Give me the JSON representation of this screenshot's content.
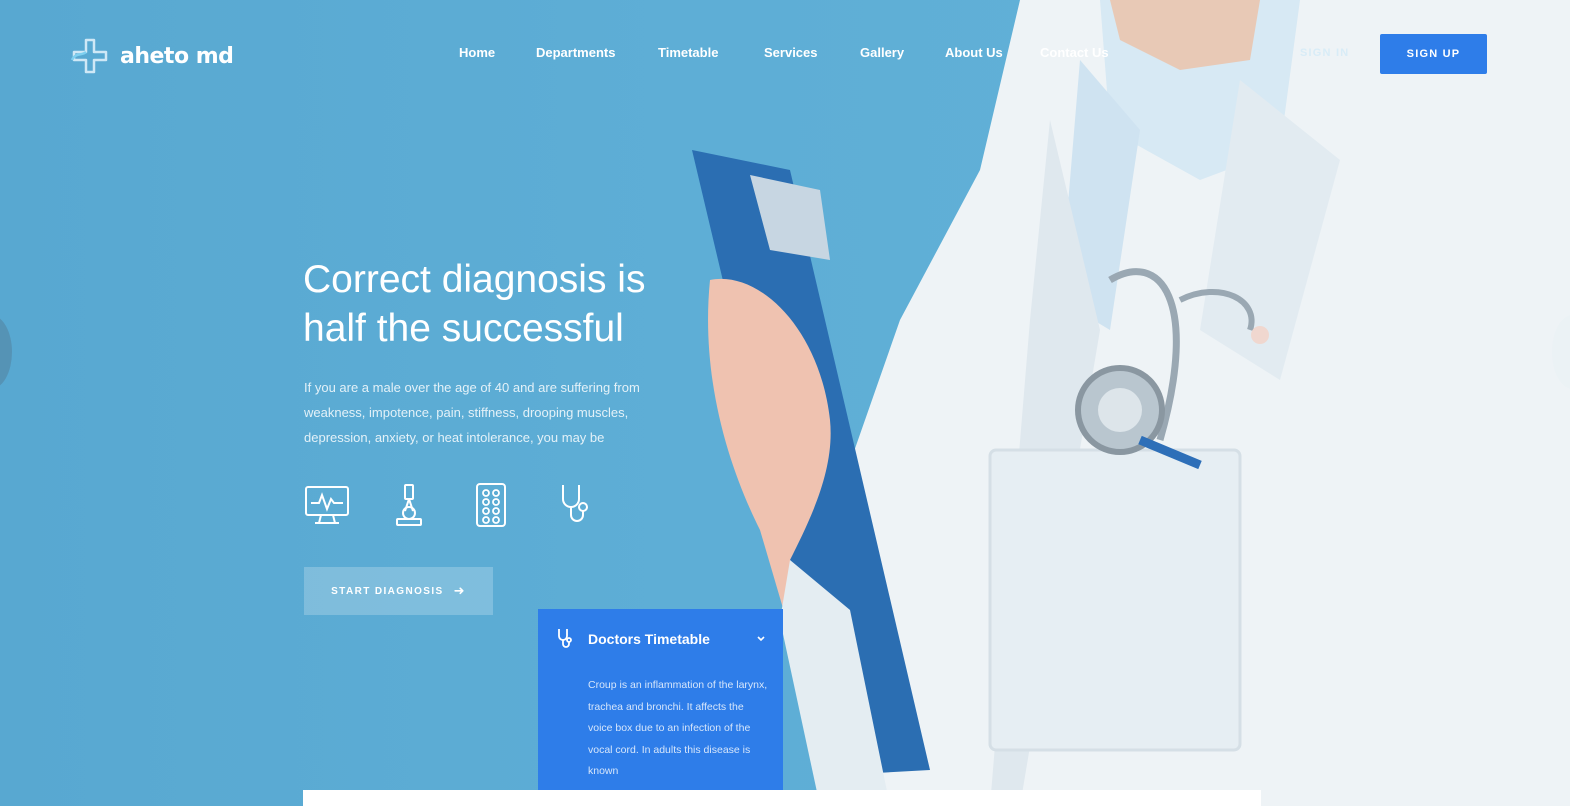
{
  "brand": {
    "name": "aheto md"
  },
  "nav": {
    "items": [
      "Home",
      "Departments",
      "Timetable",
      "Services",
      "Gallery",
      "About Us",
      "Contact Us"
    ],
    "sign_in": "SIGN IN",
    "sign_up": "SIGN UP"
  },
  "hero": {
    "title_line1": "Correct diagnosis is",
    "title_line2": "half the successful",
    "description": "If you are a male over the age of 40 and are suffering from weakness, impotence, pain, stiffness, drooping muscles, depression, anxiety, or heat intolerance, you may be",
    "features": [
      "monitor-icon",
      "microscope-icon",
      "pills-icon",
      "stethoscope-icon"
    ],
    "cta_label": "START DIAGNOSIS"
  },
  "timetable": {
    "title": "Doctors Timetable",
    "body": "Croup is an inflammation of the larynx, trachea and bronchi. It affects the voice box due to an infection of the vocal cord. In adults this disease is known"
  },
  "colors": {
    "background": "#5aaad2",
    "accent": "#2e7de9",
    "text": "#ffffff"
  }
}
